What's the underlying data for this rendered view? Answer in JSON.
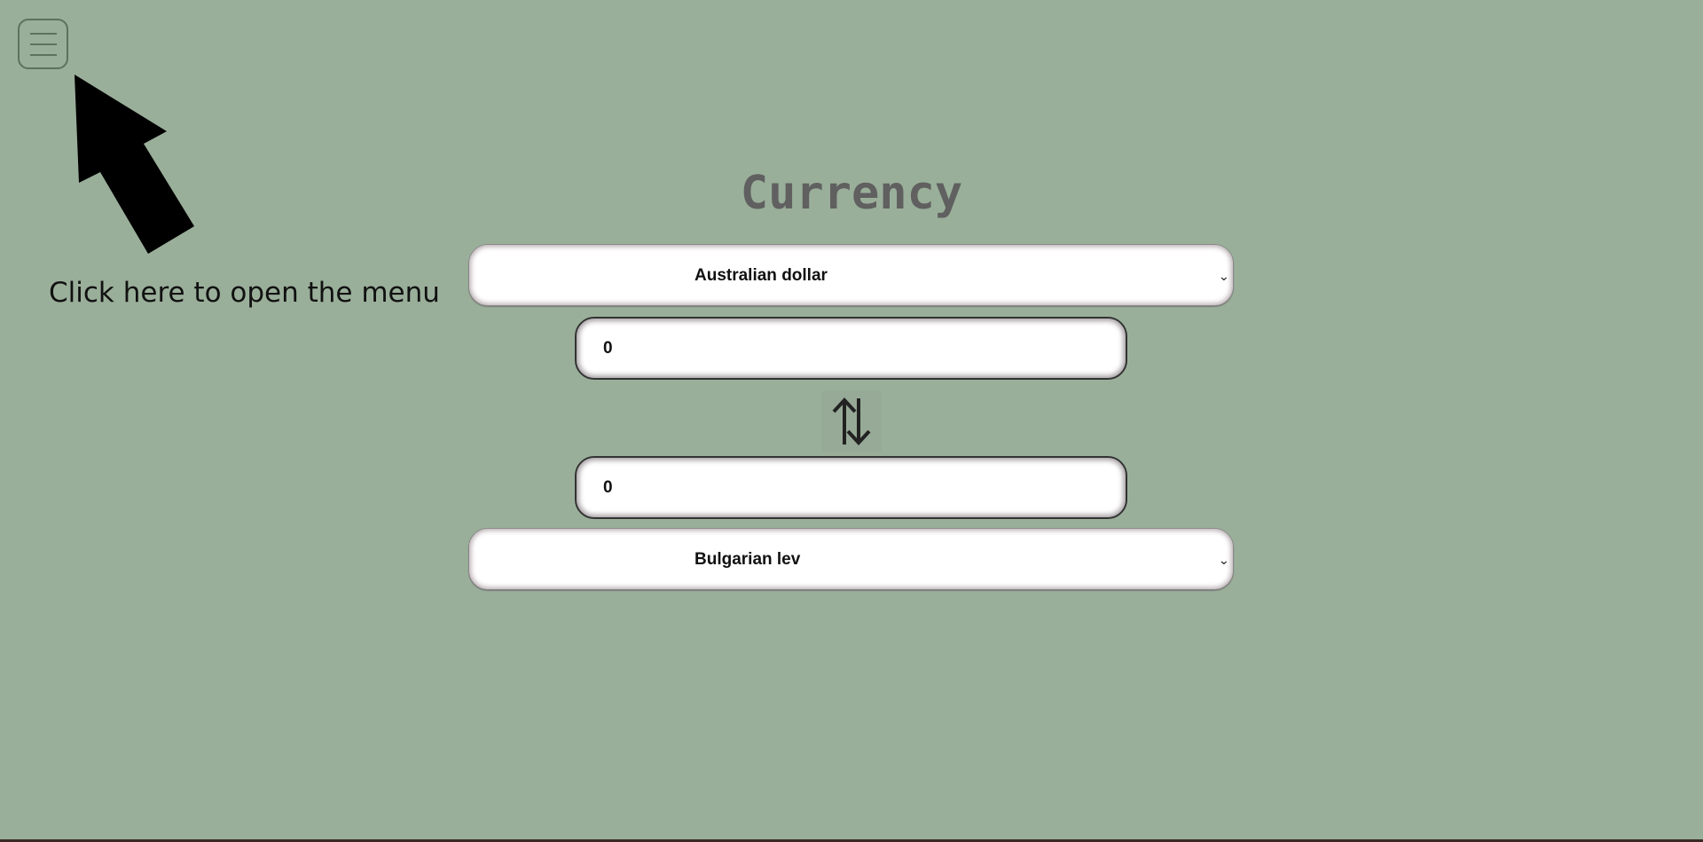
{
  "menu": {
    "button_icon": "hamburger-menu-icon",
    "hint_text": "Click here to open the menu",
    "hint_arrow_icon": "pointer-arrow-icon"
  },
  "converter": {
    "title": "Currency",
    "from_currency": "Australian dollar",
    "from_amount": "0",
    "swap_icon": "swap-arrows-icon",
    "to_amount": "0",
    "to_currency": "Bulgarian lev"
  },
  "colors": {
    "background": "#9aaf9a",
    "title": "#606060",
    "menu_icon": "#5c725c"
  }
}
